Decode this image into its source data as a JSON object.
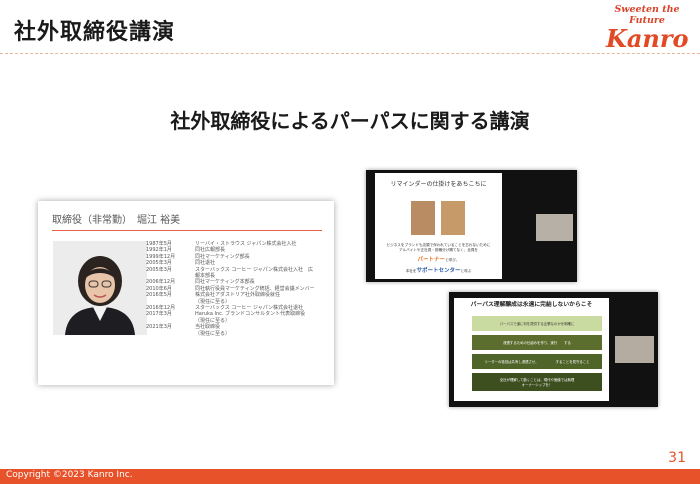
{
  "header": {
    "title": "社外取締役講演"
  },
  "logo": {
    "tagline": "Sweeten the Future",
    "brand": "Kanro"
  },
  "main": {
    "heading": "社外取締役によるパーパスに関する講演"
  },
  "profile": {
    "name": "取締役（非常勤）　堀江 裕美",
    "history": [
      {
        "date": "1987年5月",
        "text": "リーバイ・ストラウス ジャパン株式会社入社"
      },
      {
        "date": "1992年1月",
        "text": "同社広報部長"
      },
      {
        "date": "1999年12月",
        "text": "同社マーケティング部長"
      },
      {
        "date": "2005年3月",
        "text": "同社退社"
      },
      {
        "date": "2005年3月",
        "text": "スターバックス コーヒー ジャパン株式会社入社　広\n報本部長"
      },
      {
        "date": "2006年12月",
        "text": "同社マーケティング本部長"
      },
      {
        "date": "2010年6月",
        "text": "同社執行役員マーケティング統括、経営会議メンバー"
      },
      {
        "date": "2016年5月",
        "text": "株式会社アダストリア社外取締役就任\n（現任に至る）"
      },
      {
        "date": "2016年12月",
        "text": "スターバックス コーヒー ジャパン株式会社退社"
      },
      {
        "date": "2017年3月",
        "text": "Haruka Inc. ブランドコンサルタント代表取締役\n（現任に至る）"
      },
      {
        "date": "2021年3月",
        "text": "当社取締役\n（現任に至る）"
      }
    ]
  },
  "slide1": {
    "title": "リマインダーの仕掛けをあちこちに",
    "text1": "ビジネスをブランドも店頭で伴われていることを忘れないために",
    "text2": "アルバイトや正社員・役職分け隔てなく、全員を",
    "highlight": "パートナー",
    "text3": "と呼び、",
    "text4": "本社を",
    "support": "サポートセンター",
    "text5": "と呼ぶ"
  },
  "slide2": {
    "title": "パーパス理解醸成は永遠に完結しないからこそ",
    "boxes": [
      "パーパスで道に何を提供する企業なのかを明確に",
      "浸透するための仕組みを作り、実行　　する",
      "リーダーの役割は共有し浸透させ、　　　　　することを見守ること",
      "全社が理解して動くことは、現代や価値では無理\nオーナーシップを！"
    ]
  },
  "page_number": "31",
  "footer": {
    "copyright": "Copyright  ©2023  Kanro Inc."
  },
  "colors": {
    "accent": "#e8522a",
    "box_green": "#c7d89a",
    "box_dark": "#4a5a2a"
  }
}
